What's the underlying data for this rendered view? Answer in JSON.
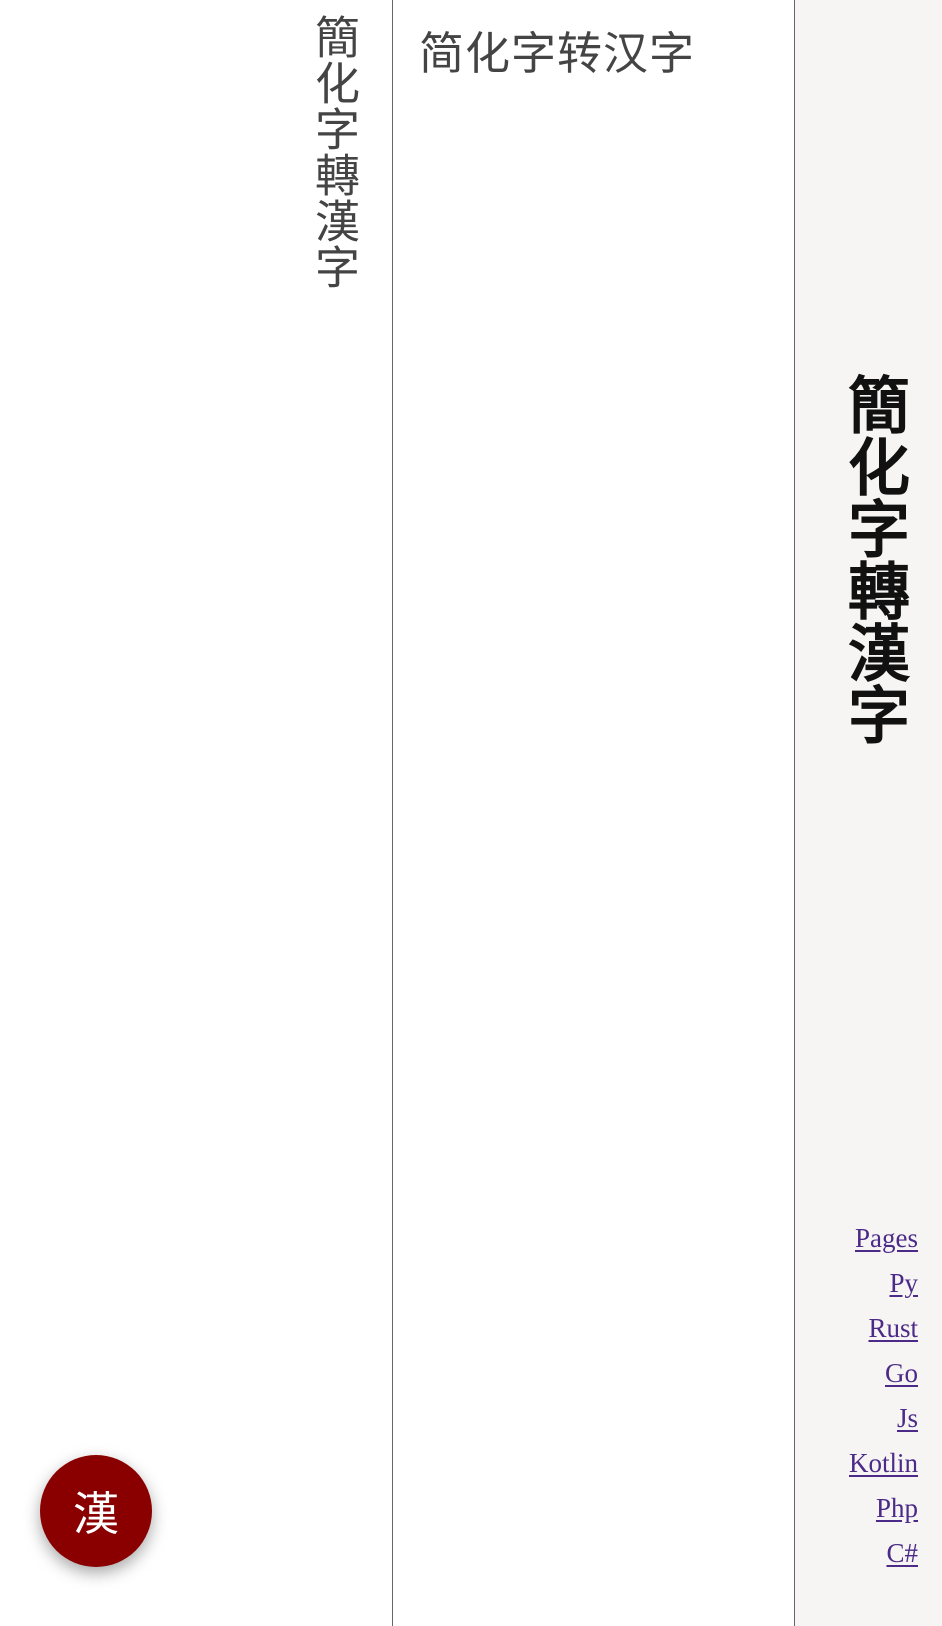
{
  "output": {
    "text": "簡化字轉漢字"
  },
  "input": {
    "text": "简化字转汉字"
  },
  "sidebar": {
    "title": "簡化字轉漢字",
    "links": [
      "Pages",
      "Py",
      "Rust",
      "Go",
      "Js",
      "Kotlin",
      "Php",
      "C#"
    ]
  },
  "fab": {
    "label": "漢",
    "color": "#8a0000"
  },
  "colors": {
    "link": "#4b2a88",
    "sidebar_bg": "#f6f5f3",
    "divider": "#666666"
  }
}
